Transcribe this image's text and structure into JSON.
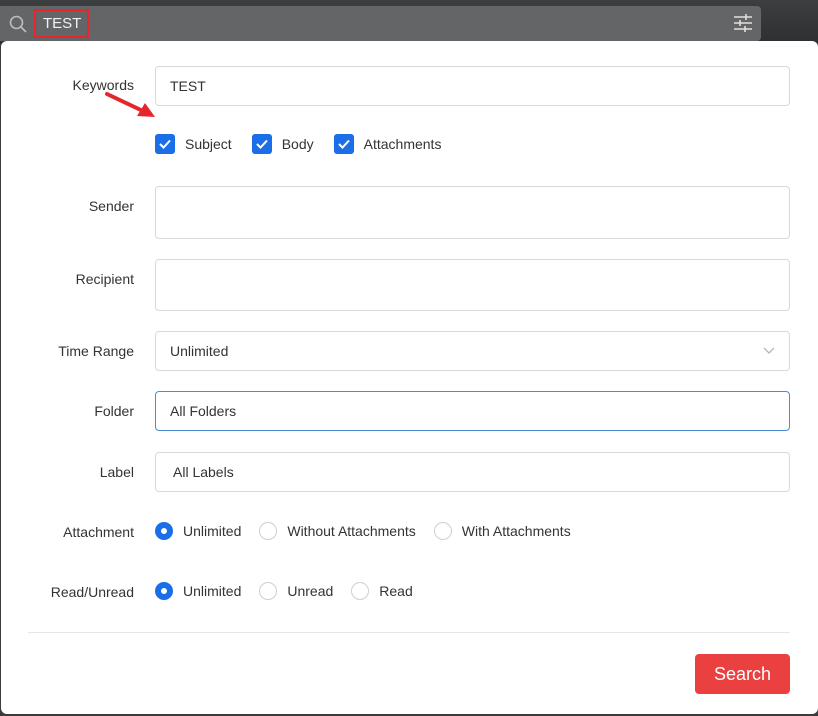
{
  "topbar": {
    "search_value": "TEST",
    "search_icon": "search-icon",
    "filter_icon": "sliders-icon"
  },
  "form": {
    "keywords": {
      "label": "Keywords",
      "value": "TEST"
    },
    "scopes": [
      {
        "label": "Subject",
        "checked": true
      },
      {
        "label": "Body",
        "checked": true
      },
      {
        "label": "Attachments",
        "checked": true
      }
    ],
    "sender": {
      "label": "Sender",
      "value": ""
    },
    "recipient": {
      "label": "Recipient",
      "value": ""
    },
    "time_range": {
      "label": "Time Range",
      "value": "Unlimited"
    },
    "folder": {
      "label": "Folder",
      "value": "All Folders"
    },
    "label_field": {
      "label": "Label",
      "value": "All Labels"
    },
    "attachment": {
      "label": "Attachment",
      "options": [
        "Unlimited",
        "Without Attachments",
        "With Attachments"
      ],
      "selected": "Unlimited"
    },
    "read_unread": {
      "label": "Read/Unread",
      "options": [
        "Unlimited",
        "Unread",
        "Read"
      ],
      "selected": "Unlimited"
    },
    "search_label": "Search"
  },
  "colors": {
    "accent": "#1a6fe8",
    "search_button": "#eb4040",
    "highlight_box": "#e5262c"
  }
}
